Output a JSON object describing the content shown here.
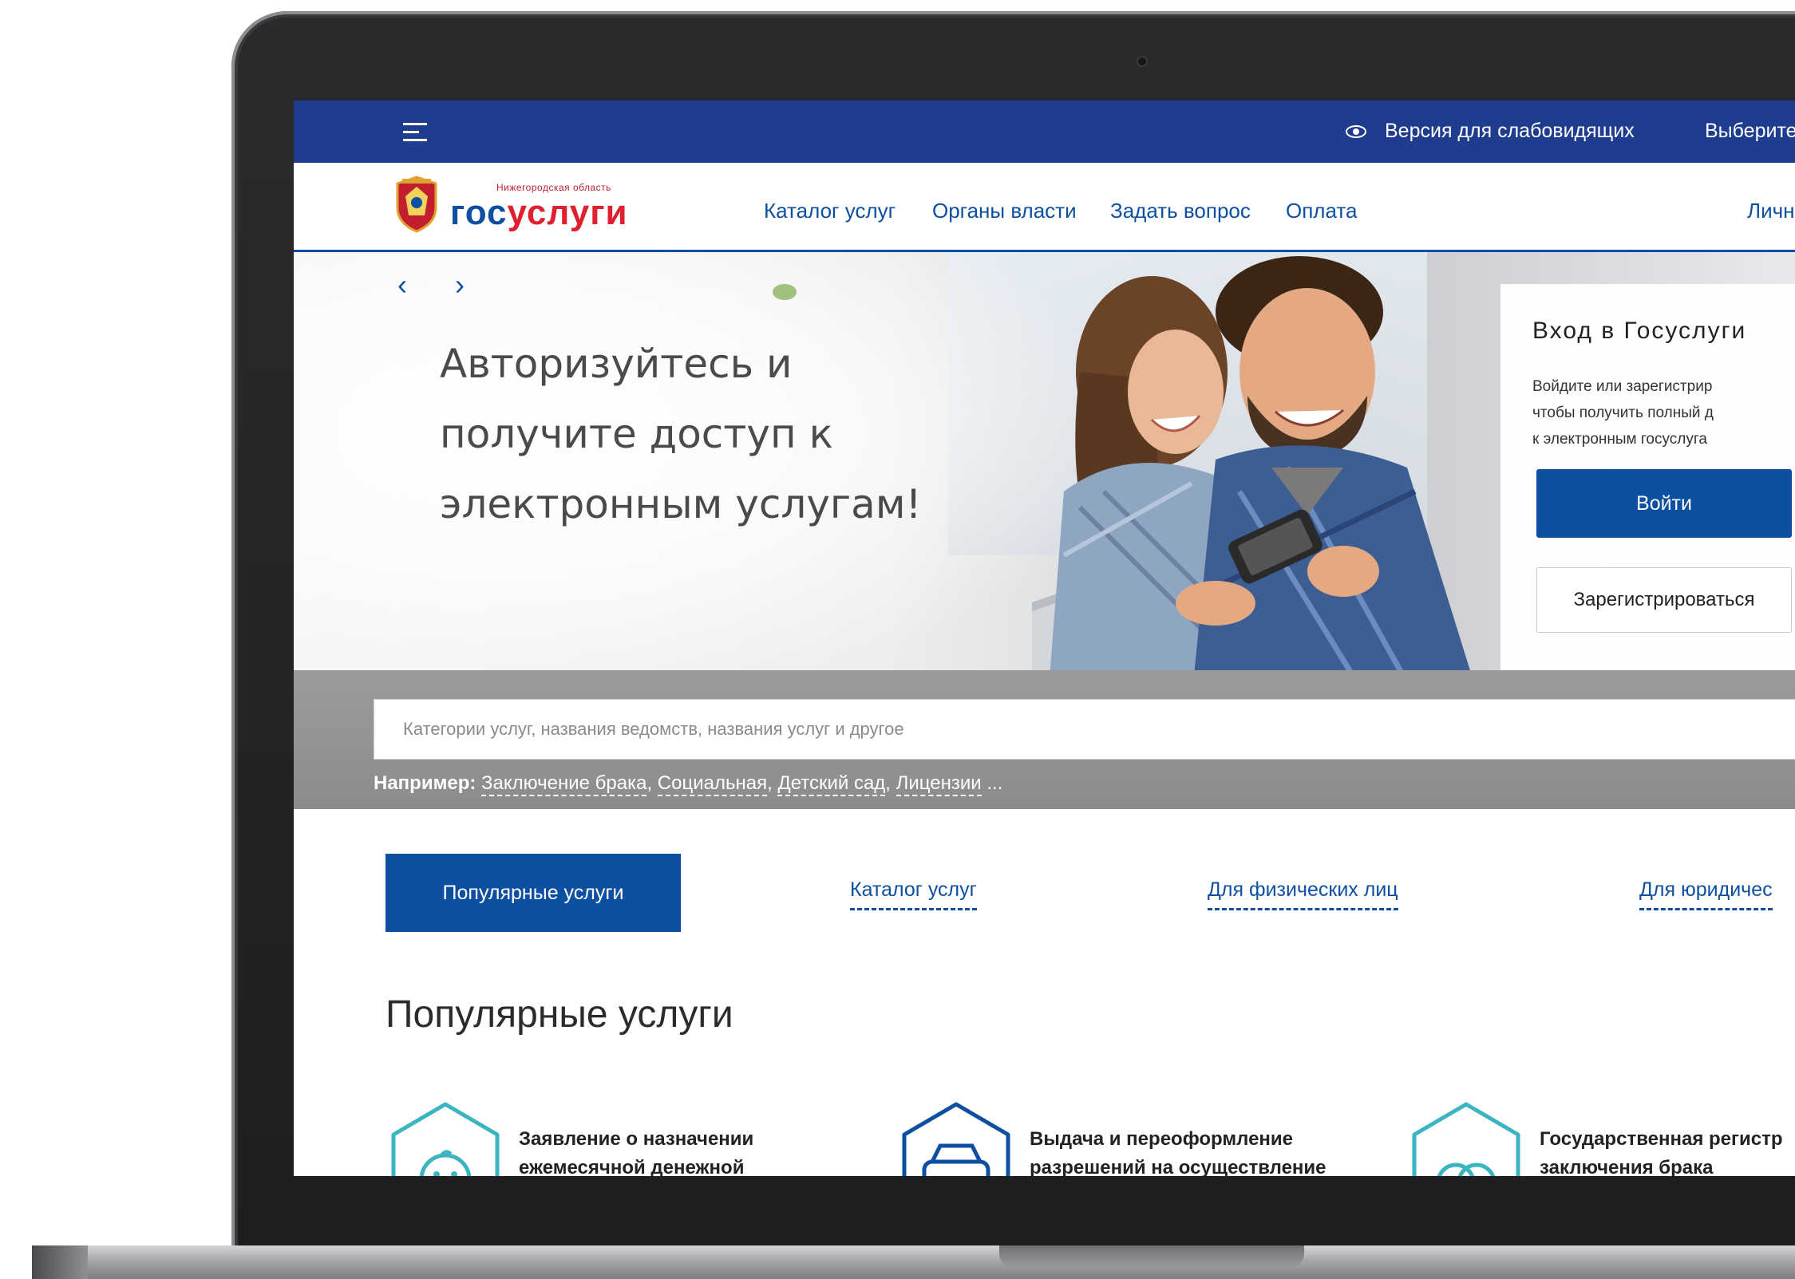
{
  "topbar": {
    "accessibility": "Версия для слабовидящих",
    "region": "Выберите"
  },
  "header": {
    "logo_region": "Нижегородская область",
    "logo_gos": "гос",
    "logo_uslugi": "услуги",
    "nav": [
      "Каталог услуг",
      "Органы власти",
      "Задать вопрос",
      "Оплата"
    ],
    "cabinet": "Личн"
  },
  "hero": {
    "prev": "‹",
    "next": "›",
    "headline": "Авторизуйтесь и получите доступ к электронным услугам!"
  },
  "login": {
    "title": "Вход в Госуслуги",
    "description": "Войдите или зарегистрир\nчтобы получить полный д\nк электронным госуслуга",
    "login_label": "Войти",
    "register_label": "Зарегистрироваться"
  },
  "search": {
    "placeholder": "Категории услуг, названия ведомств, названия услуг и другое",
    "examples_label": "Например:",
    "examples": [
      "Заключение брака",
      "Социальная",
      "Детский сад",
      "Лицензии"
    ],
    "more": " ..."
  },
  "tabs": {
    "popular": "Популярные услуги",
    "catalog": "Каталог услуг",
    "individuals": "Для физических лиц",
    "legal": "Для юридичес"
  },
  "popular_heading": "Популярные услуги",
  "services": [
    {
      "title": "Заявление о назначении\nежемесячной денежной",
      "icon": "baby-icon"
    },
    {
      "title": "Выдача и переоформление\nразрешений на осуществление",
      "icon": "car-icon"
    },
    {
      "title": "Государственная регистр\nзаключения брака",
      "icon": "rings-icon"
    }
  ],
  "colors": {
    "topbar": "#1f3d8f",
    "primary": "#0d4fa1",
    "brand_red": "#e0202e",
    "teal_icon": "#3bb5c2"
  }
}
